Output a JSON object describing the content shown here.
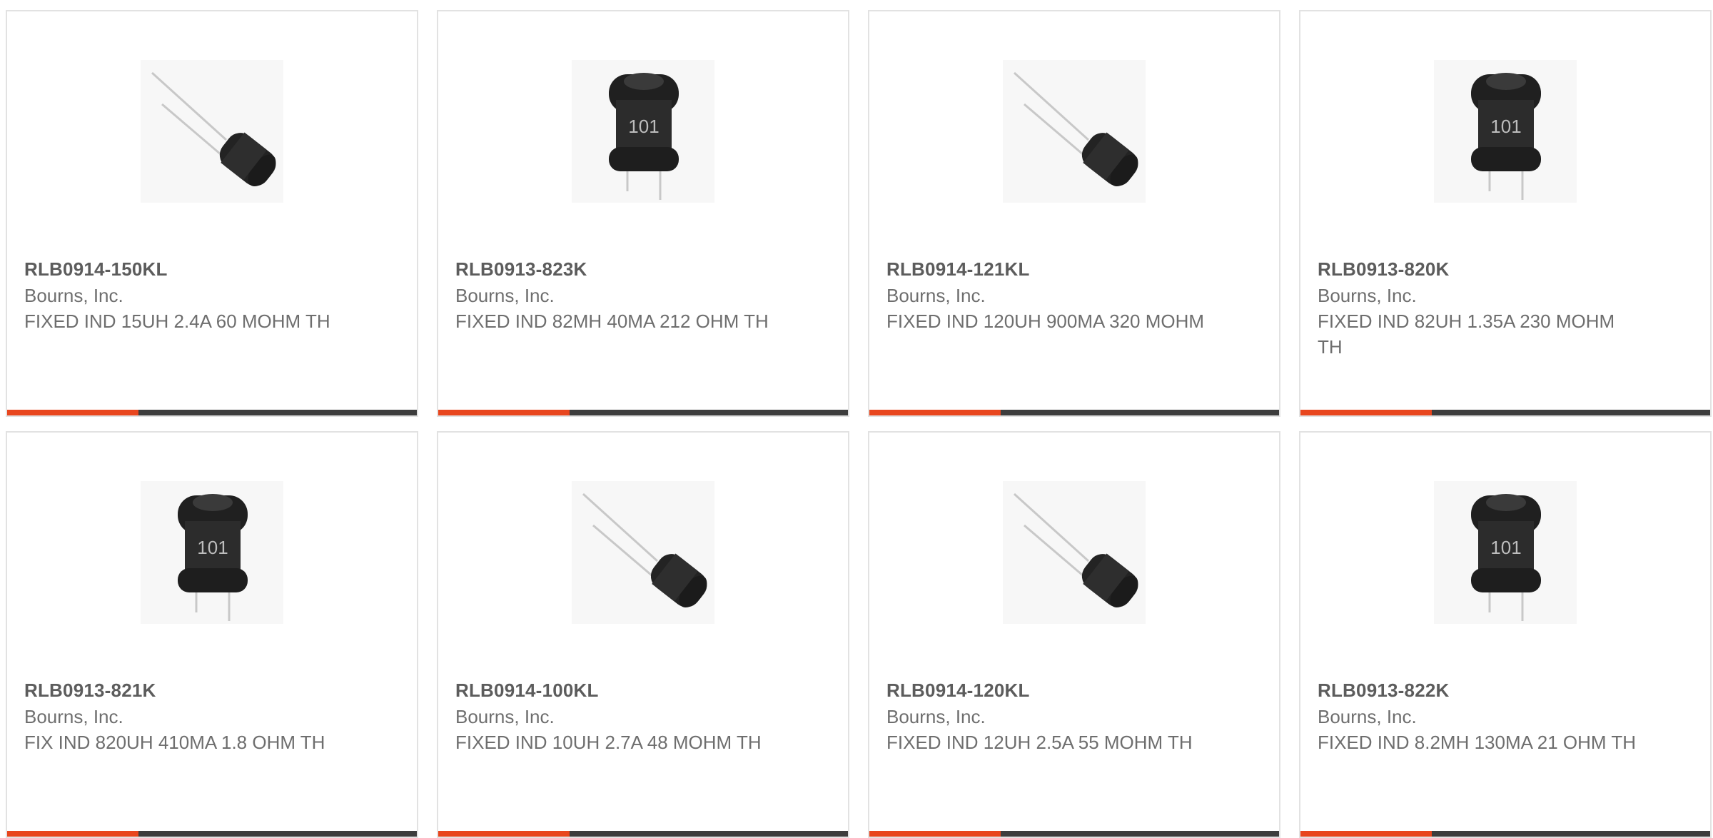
{
  "colors": {
    "accent": "#e8461e",
    "bar": "#3d3d3d"
  },
  "products": [
    {
      "part_number": "RLB0914-150KL",
      "manufacturer": "Bourns, Inc.",
      "description": "FIXED IND 15UH 2.4A 60 MOHM TH",
      "image": "radial-inductor-angled-icon"
    },
    {
      "part_number": "RLB0913-823K",
      "manufacturer": "Bourns, Inc.",
      "description": "FIXED IND 82MH 40MA 212 OHM TH",
      "image": "radial-inductor-upright-icon",
      "marking": "101"
    },
    {
      "part_number": "RLB0914-121KL",
      "manufacturer": "Bourns, Inc.",
      "description": "FIXED IND 120UH 900MA 320 MOHM",
      "image": "radial-inductor-angled-icon"
    },
    {
      "part_number": "RLB0913-820K",
      "manufacturer": "Bourns, Inc.",
      "description": "FIXED IND 82UH 1.35A 230 MOHM TH",
      "image": "radial-inductor-upright-icon",
      "marking": "101"
    },
    {
      "part_number": "RLB0913-821K",
      "manufacturer": "Bourns, Inc.",
      "description": "FIX IND 820UH 410MA 1.8 OHM TH",
      "image": "radial-inductor-upright-icon",
      "marking": "101"
    },
    {
      "part_number": "RLB0914-100KL",
      "manufacturer": "Bourns, Inc.",
      "description": "FIXED IND 10UH 2.7A 48 MOHM TH",
      "image": "radial-inductor-angled-icon"
    },
    {
      "part_number": "RLB0914-120KL",
      "manufacturer": "Bourns, Inc.",
      "description": "FIXED IND 12UH 2.5A 55 MOHM TH",
      "image": "radial-inductor-angled-icon"
    },
    {
      "part_number": "RLB0913-822K",
      "manufacturer": "Bourns, Inc.",
      "description": "FIXED IND 8.2MH 130MA 21 OHM TH",
      "image": "radial-inductor-upright-icon",
      "marking": "101"
    }
  ]
}
